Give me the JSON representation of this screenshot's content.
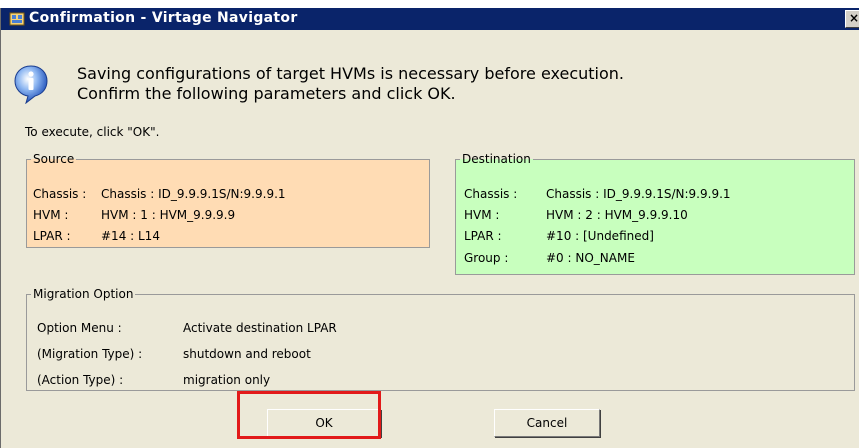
{
  "window": {
    "title": "Confirmation - Virtage Navigator",
    "close_label": "×"
  },
  "message": {
    "line1": "Saving configurations of target HVMs is necessary before execution.",
    "line2": "Confirm the following parameters and click OK."
  },
  "execute_note": "To execute, click \"OK\".",
  "source": {
    "legend": "Source",
    "rows": [
      {
        "label": "Chassis :",
        "value": "Chassis : ID_9.9.9.1S/N:9.9.9.1"
      },
      {
        "label": "HVM :",
        "value": "HVM : 1 : HVM_9.9.9.9"
      },
      {
        "label": "LPAR :",
        "value": "#14 : L14"
      }
    ]
  },
  "destination": {
    "legend": "Destination",
    "rows": [
      {
        "label": "Chassis :",
        "value": "Chassis : ID_9.9.9.1S/N:9.9.9.1"
      },
      {
        "label": "HVM :",
        "value": "HVM : 2 : HVM_9.9.9.10"
      },
      {
        "label": "LPAR :",
        "value": "#10 : [Undefined]"
      },
      {
        "label": "Group :",
        "value": "#0 : NO_NAME"
      }
    ]
  },
  "migration": {
    "legend": "Migration Option",
    "rows": [
      {
        "label": "Option Menu :",
        "value": "Activate destination LPAR"
      },
      {
        "label": "(Migration Type) :",
        "value": "shutdown and reboot"
      },
      {
        "label": "(Action Type) :",
        "value": "migration only"
      }
    ]
  },
  "buttons": {
    "ok": "OK",
    "cancel": "Cancel"
  },
  "colors": {
    "source_bg": "#ffdcb4",
    "destination_bg": "#c8ffbe",
    "titlebar": "#0a246a",
    "highlight": "#e21a1a"
  },
  "icons": {
    "title": "app-window-icon",
    "info": "info-icon"
  }
}
